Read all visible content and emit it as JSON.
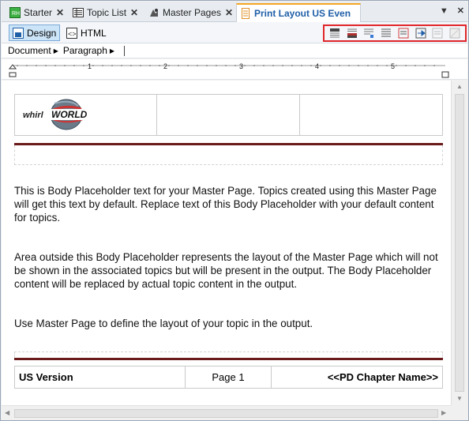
{
  "tabs": [
    {
      "label": "Starter",
      "icon": "starter-icon"
    },
    {
      "label": "Topic List",
      "icon": "topic-list-icon"
    },
    {
      "label": "Master Pages",
      "icon": "master-pages-icon"
    },
    {
      "label": "Print Layout US Even",
      "icon": "print-layout-icon",
      "active": true
    }
  ],
  "toolbar": {
    "design_label": "Design",
    "html_label": "HTML",
    "layout_icons": [
      "insert-header-icon",
      "insert-footer-icon",
      "insert-header-row-icon",
      "insert-body-icon",
      "insert-section-icon",
      "insert-marker-icon",
      "insert-placeholder-icon",
      "insert-frame-icon"
    ]
  },
  "breadcrumb": {
    "document_label": "Document",
    "paragraph_label": "Paragraph"
  },
  "ruler": {
    "ticks": [
      "1",
      "2",
      "3",
      "4",
      "5"
    ]
  },
  "header": {
    "logo_text_left": "whirl",
    "logo_text_right": "WORLD"
  },
  "body": {
    "paragraphs": [
      "This is Body Placeholder text for your Master Page. Topics created using this Master Page will get this text by default. Replace text of this Body Placeholder with your default content for topics.",
      "Area outside this Body Placeholder represents the layout of the Master Page which will not be shown in the associated topics but will be present in the output. The Body Placeholder content will be replaced by actual topic content in the output.",
      "Use Master Page to define the layout of your topic in the output."
    ]
  },
  "footer": {
    "version": "US Version",
    "page": "Page 1",
    "chapter": "<<PD Chapter Name>>"
  },
  "colors": {
    "accent_rule": "#6a1a1a",
    "highlight_box": "#e0262a",
    "active_tab": "#1f5fa8"
  }
}
